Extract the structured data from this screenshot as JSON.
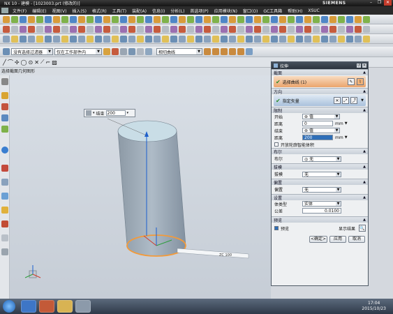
{
  "titlebar": {
    "app_title": "NX 10 - 建模 - [1023003.prt (修改的)]",
    "brand": "SIEMENS"
  },
  "menubar": {
    "items": [
      "文件(F)",
      "编辑(E)",
      "视图(V)",
      "插入(S)",
      "格式(R)",
      "工具(T)",
      "装配(A)",
      "信息(I)",
      "分析(L)",
      "首选项(P)",
      "应用模块(N)",
      "窗口(O)",
      "GC工具箱",
      "帮助(H)",
      "XSUC"
    ]
  },
  "filterbar": {
    "type_filter": "没有选择过滤器",
    "scope_filter": "仅在工作部件内",
    "curve_rule": "相切曲线"
  },
  "hint": "选择截面几何图形",
  "dimension_widget": {
    "label": "结束",
    "value": "200"
  },
  "viewport": {
    "dim_annotation": "ZC 100"
  },
  "dialog": {
    "title": "拉伸",
    "sections": {
      "section": {
        "header": "截面",
        "select_label": "选择曲线 (1)"
      },
      "direction": {
        "header": "方向",
        "specify_label": "指定矢量"
      },
      "limits": {
        "header": "限制",
        "start_label": "开始",
        "start_value": "值",
        "start_dist_label": "距离",
        "start_dist": "0",
        "end_label": "结束",
        "end_value": "值",
        "end_dist_label": "距离",
        "end_dist": "200",
        "unit": "mm",
        "open_profile": "开放轮廓智能体积"
      },
      "boolean": {
        "header": "布尔",
        "label": "布尔",
        "value": "无"
      },
      "draft": {
        "header": "拔模",
        "label": "拔模",
        "value": "无"
      },
      "offset": {
        "header": "偏置",
        "label": "偏置",
        "value": "无"
      },
      "settings": {
        "header": "设置",
        "body_type_label": "体类型",
        "body_type": "实体",
        "tolerance_label": "公差",
        "tolerance": "0.0100"
      },
      "preview": {
        "header": "预览",
        "preview_label": "预览",
        "show_result": "显示结果"
      }
    },
    "buttons": {
      "ok": "<确定>",
      "apply": "应用",
      "cancel": "取消"
    }
  },
  "taskbar": {
    "time": "17:04",
    "date": "2015/10/23"
  },
  "colors": {
    "cylinder": "#a9b6c2",
    "cylinder_top": "#c9dde6",
    "highlight_orange": "#f39a3a",
    "vector_blue": "#1a5fd0"
  }
}
